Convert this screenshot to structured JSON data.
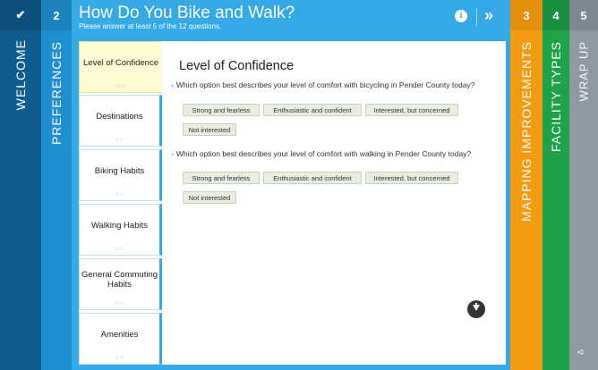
{
  "tabs": {
    "welcome": {
      "num": "✔",
      "label": "WELCOME"
    },
    "preferences": {
      "num": "2",
      "label": "PREFERENCES"
    },
    "mapping": {
      "num": "3",
      "label": "MAPPING IMPROVEMENTS"
    },
    "facility": {
      "num": "4",
      "label": "FACILITY TYPES"
    },
    "wrap": {
      "num": "5",
      "label": "WRAP UP"
    }
  },
  "header": {
    "title": "How Do You Bike and Walk?",
    "subtitle": "Please answer at least 5 of the 12 questions.",
    "info_glyph": "i",
    "next_glyph": "»"
  },
  "sidebar": {
    "items": [
      {
        "label": "Level of Confidence",
        "dots": "○○"
      },
      {
        "label": "Destinations",
        "dots": "○○"
      },
      {
        "label": "Biking Habits",
        "dots": "○○"
      },
      {
        "label": "Walking Habits",
        "dots": "○○"
      },
      {
        "label": "General Commuting Habits",
        "dots": "○○"
      },
      {
        "label": "Amenities",
        "dots": "○○"
      }
    ]
  },
  "content": {
    "heading": "Level of Confidence",
    "questions": [
      {
        "text": "Which option best describes your level of comfort with bicycling in Pender County today?",
        "options": [
          "Strong and fearless",
          "Enthusiastic and confident",
          "Interested, but concerned",
          "Not interested"
        ]
      },
      {
        "text": "Which option best describes your level of comfort with walking in Pender County today?",
        "options": [
          "Strong and fearless",
          "Enthusiastic and confident",
          "Interested, but concerned",
          "Not interested"
        ]
      }
    ]
  },
  "colors": {
    "welcome": "#0f5d8f",
    "preferences": "#1e8fd0",
    "main": "#34a9e6",
    "mapping": "#f39c12",
    "facility": "#1fa34a",
    "wrap": "#8e99a3"
  }
}
